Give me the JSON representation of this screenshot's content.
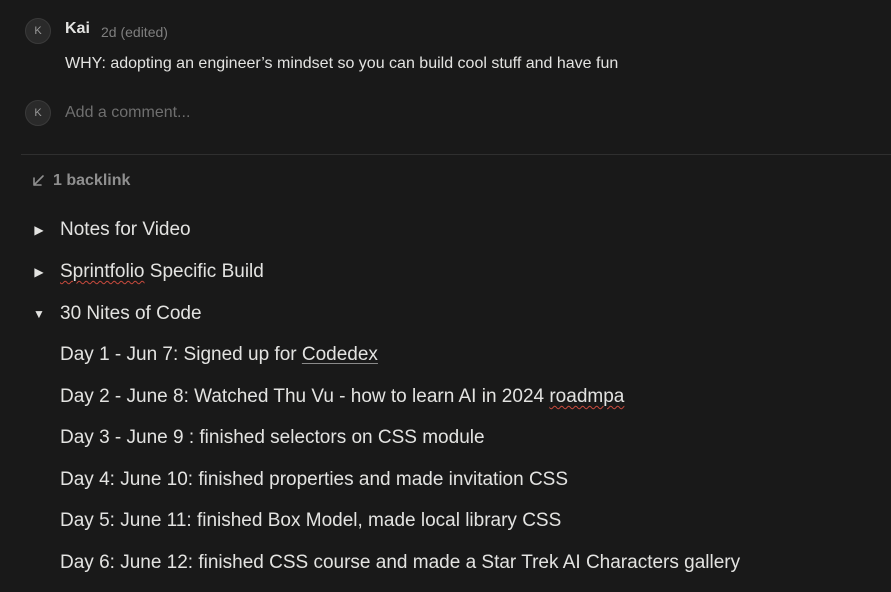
{
  "comment": {
    "avatar_initial": "K",
    "author": "Kai",
    "meta": "2d (edited)",
    "body": "WHY: adopting an engineer’s mindset so you can build cool stuff and have fun"
  },
  "add_comment": {
    "avatar_initial": "K",
    "placeholder": "Add a comment..."
  },
  "backlinks": {
    "label": "1 backlink",
    "icon": "arrow-down-left-icon"
  },
  "toggles": [
    {
      "label": "Notes for Video",
      "expanded": false
    },
    {
      "label_prefix": "",
      "label_squiggle": "Sprintfolio",
      "label_suffix": " Specific Build",
      "expanded": false
    },
    {
      "label": "30 Nites of Code",
      "expanded": true
    }
  ],
  "days": [
    {
      "prefix": "Day 1 - Jun 7: Signed up for ",
      "link": "Codedex",
      "suffix": ""
    },
    {
      "prefix": "Day 2 - June 8: Watched Thu Vu - how to learn AI in 2024 ",
      "squiggle": "roadmpa"
    },
    {
      "text": "Day 3 - June 9 : finished selectors on CSS module"
    },
    {
      "text": "Day 4: June 10: finished properties and made invitation CSS"
    },
    {
      "text": "Day 5: June 11: finished Box Model, made local library CSS"
    },
    {
      "text": "Day 6: June 12: finished CSS course and made a Star Trek AI Characters gallery"
    }
  ],
  "colors": {
    "background": "#191919",
    "text": "#e3e3e1",
    "muted": "#7f7f7f",
    "spellcheck": "#c84a3d"
  }
}
